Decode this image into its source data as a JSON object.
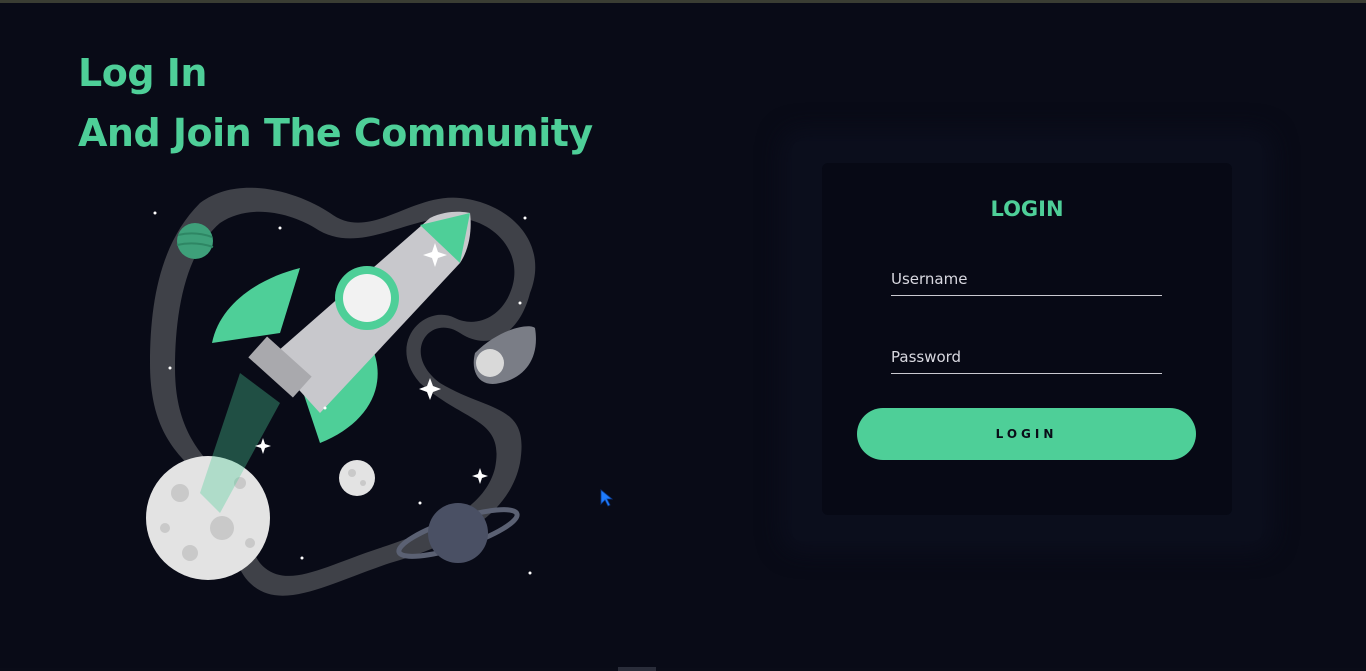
{
  "headline": {
    "line1": "Log In",
    "line2": "And Join The Community"
  },
  "login_card": {
    "title": "LOGIN",
    "username_placeholder": "Username",
    "password_placeholder": "Password",
    "button_label": "LOGIN"
  },
  "colors": {
    "accent": "#4ecf98",
    "background": "#090b17",
    "card": "#070915"
  },
  "illustration": {
    "icon": "rocket-space-illustration"
  }
}
